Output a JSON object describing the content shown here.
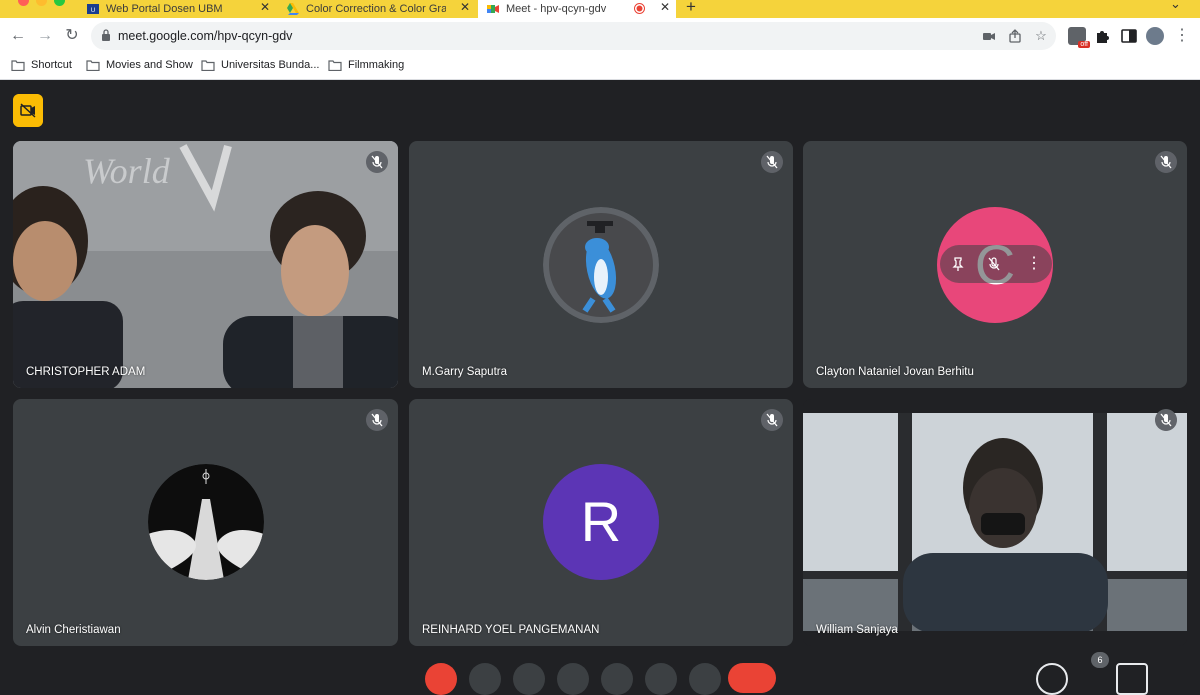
{
  "browser": {
    "tabs": [
      {
        "title": "Web Portal Dosen UBM",
        "active": false
      },
      {
        "title": "Color Correction & Color Grad",
        "active": false
      },
      {
        "title": "Meet - hpv-qcyn-gdv",
        "active": true
      }
    ],
    "url": "meet.google.com/hpv-qcyn-gdv",
    "extension_badge": "off",
    "bookmarks": [
      {
        "label": "Shortcut"
      },
      {
        "label": "Movies and Show"
      },
      {
        "label": "Universitas Bunda..."
      },
      {
        "label": "Filmmaking"
      }
    ]
  },
  "meet": {
    "participants": [
      {
        "name": "CHRISTOPHER ADAM",
        "type": "video"
      },
      {
        "name": "M.Garry Saputra",
        "type": "avatar-image"
      },
      {
        "name": "Clayton Nataniel Jovan Berhitu",
        "type": "letter",
        "letter": "C",
        "color": "#e8477a"
      },
      {
        "name": "Alvin Cheristiawan",
        "type": "avatar-image"
      },
      {
        "name": "REINHARD YOEL PANGEMANAN",
        "type": "letter",
        "letter": "R",
        "color": "#5c35b5"
      },
      {
        "name": "William Sanjaya",
        "type": "video"
      }
    ],
    "people_count": "6"
  },
  "colors": {
    "tabbar": "#f5d33b",
    "meet_bg": "#202124",
    "tile_bg": "#3c4043",
    "end_call": "#ea4335"
  }
}
